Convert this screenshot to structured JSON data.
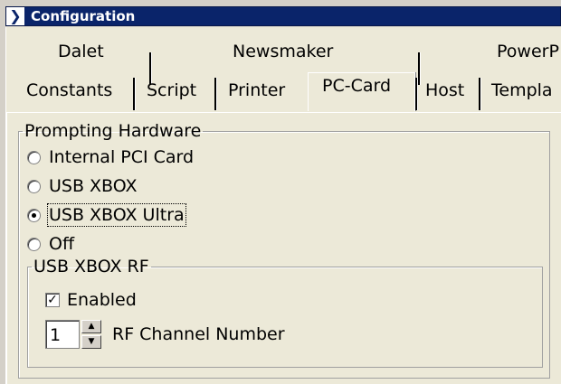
{
  "window": {
    "title": "Configuration",
    "title_icon": "chevron-right-icon"
  },
  "tabs_back": [
    "Dalet",
    "Newsmaker",
    "PowerP"
  ],
  "tabs_front": [
    "Constants",
    "Script",
    "Printer",
    "PC-Card",
    "Host",
    "Templa"
  ],
  "active_tab": "PC-Card",
  "prompting_hardware": {
    "legend": "Prompting Hardware",
    "options": [
      {
        "label": "Internal PCI Card",
        "selected": false
      },
      {
        "label": "USB XBOX",
        "selected": false
      },
      {
        "label": "USB XBOX Ultra",
        "selected": true
      },
      {
        "label": "Off",
        "selected": false
      }
    ]
  },
  "usb_xbox_rf": {
    "legend": "USB XBOX RF",
    "enabled_label": "Enabled",
    "enabled_checked": true,
    "channel_value": "1",
    "channel_label": "RF Channel Number"
  }
}
